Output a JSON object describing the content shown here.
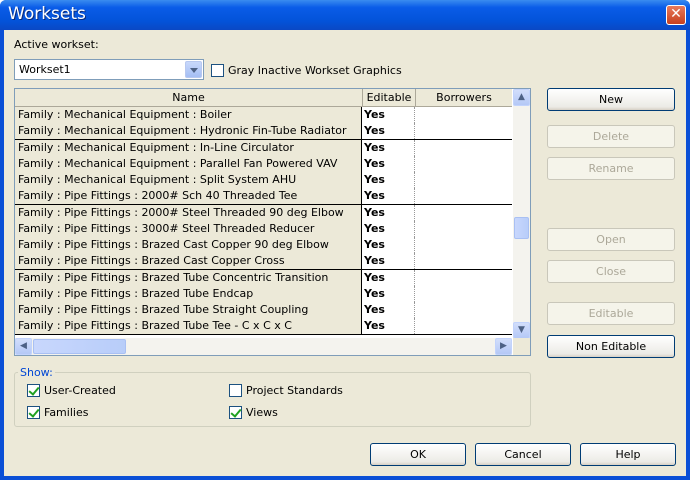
{
  "window": {
    "title": "Worksets",
    "close_glyph": "✕"
  },
  "active_workset": {
    "label": "Active workset:",
    "value": "Workset1"
  },
  "gray_inactive": {
    "label": "Gray Inactive Workset Graphics",
    "checked": false
  },
  "grid": {
    "columns": [
      "Name",
      "Editable",
      "Borrowers"
    ],
    "rows": [
      {
        "name": "Family  : Mechanical Equipment : Boiler",
        "editable": "Yes",
        "borrowers": ""
      },
      {
        "name": "Family  : Mechanical Equipment : Hydronic Fin-Tube Radiator",
        "editable": "Yes",
        "borrowers": ""
      },
      {
        "name": "Family  : Mechanical Equipment : In-Line Circulator",
        "editable": "Yes",
        "borrowers": ""
      },
      {
        "name": "Family  : Mechanical Equipment : Parallel Fan Powered VAV",
        "editable": "Yes",
        "borrowers": ""
      },
      {
        "name": "Family  : Mechanical Equipment : Split System AHU",
        "editable": "Yes",
        "borrowers": ""
      },
      {
        "name": "Family  : Pipe Fittings : 2000# Sch 40 Threaded Tee",
        "editable": "Yes",
        "borrowers": ""
      },
      {
        "name": "Family  : Pipe Fittings : 2000# Steel Threaded 90 deg Elbow",
        "editable": "Yes",
        "borrowers": ""
      },
      {
        "name": "Family  : Pipe Fittings : 3000# Steel Threaded Reducer",
        "editable": "Yes",
        "borrowers": ""
      },
      {
        "name": "Family  : Pipe Fittings : Brazed Cast Copper 90 deg Elbow",
        "editable": "Yes",
        "borrowers": ""
      },
      {
        "name": "Family  : Pipe Fittings : Brazed Cast Copper Cross",
        "editable": "Yes",
        "borrowers": ""
      },
      {
        "name": "Family  : Pipe Fittings : Brazed Tube Concentric Transition",
        "editable": "Yes",
        "borrowers": ""
      },
      {
        "name": "Family  : Pipe Fittings : Brazed Tube Endcap",
        "editable": "Yes",
        "borrowers": ""
      },
      {
        "name": "Family  : Pipe Fittings : Brazed Tube Straight Coupling",
        "editable": "Yes",
        "borrowers": ""
      },
      {
        "name": "Family  : Pipe Fittings : Brazed Tube Tee - C x C x C",
        "editable": "Yes",
        "borrowers": ""
      }
    ],
    "vscroll_position": 0.6,
    "hscroll_position": 0.0
  },
  "buttons": {
    "new": "New",
    "delete": "Delete",
    "rename": "Rename",
    "open": "Open",
    "close": "Close",
    "editable": "Editable",
    "non_editable": "Non Editable",
    "ok": "OK",
    "cancel": "Cancel",
    "help": "Help"
  },
  "show": {
    "label": "Show:",
    "user_created": {
      "label": "User-Created",
      "checked": true
    },
    "families": {
      "label": "Families",
      "checked": true
    },
    "project_standards": {
      "label": "Project Standards",
      "checked": false
    },
    "views": {
      "label": "Views",
      "checked": true
    }
  },
  "colors": {
    "titlebar": "#0353d9",
    "dialog_bg": "#ece9d8",
    "group_label": "#0046d5"
  }
}
